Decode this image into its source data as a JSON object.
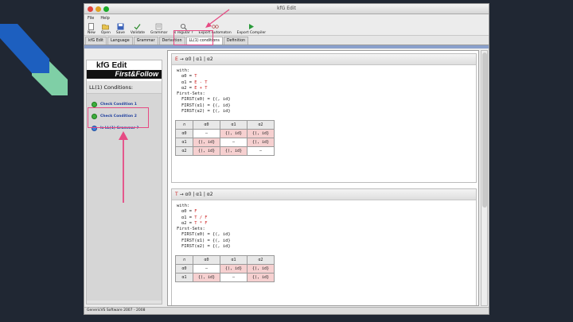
{
  "colors": {
    "background": "#202733",
    "deco_blue": "#1d5fbf",
    "deco_green": "#7fcfa6",
    "highlight": "#e64a83"
  },
  "window": {
    "title": "kfG Edit"
  },
  "menu": [
    "File",
    "Help"
  ],
  "toolbar": [
    {
      "label": "New",
      "icon": "new-file-icon"
    },
    {
      "label": "Open",
      "icon": "open-folder-icon"
    },
    {
      "label": "Save",
      "icon": "save-icon"
    },
    {
      "label": "Validate",
      "icon": "validate-icon"
    },
    {
      "label": "Grammar",
      "icon": "grammar-icon"
    },
    {
      "label": "Is regular ?",
      "icon": "regular-check-icon"
    },
    {
      "label": "Export Automaton",
      "icon": "export-automaton-icon"
    },
    {
      "label": "Export Compiler",
      "icon": "export-compiler-icon"
    }
  ],
  "tabs": [
    "kfG Edit",
    "Language",
    "Grammar",
    "Derivation",
    "LL(1) conditions",
    "Definition"
  ],
  "active_tab": "LL(1) conditions",
  "sidebar": {
    "logo_top": "kfG Edit",
    "logo_bottom": "First&Follow",
    "heading": "LL(1) Conditions:",
    "items": [
      {
        "label": "Check Condition 1"
      },
      {
        "label": "Check Condition 2"
      },
      {
        "label": "Is LL(1) Grammar ?"
      }
    ]
  },
  "block1": {
    "lhs": "E",
    "arrow": "→",
    "rhs": "α0 | α1 | α2",
    "with_label": "with:",
    "defs": [
      {
        "name": "α0",
        "eq": "=",
        "val": "T"
      },
      {
        "name": "α1",
        "eq": "=",
        "val": "E - T"
      },
      {
        "name": "α2",
        "eq": "=",
        "val": "E + T"
      }
    ],
    "first_label": "First-Sets:",
    "firsts": [
      "FIRST(α0) = {(, id}",
      "FIRST(α1) = {(, id}",
      "FIRST(α2) = {(, id}"
    ],
    "table": {
      "corner": "∩",
      "headers": [
        "α0",
        "α1",
        "α2"
      ],
      "rows": [
        {
          "label": "α0",
          "cells": [
            "–",
            "{(, id}",
            "{(, id}"
          ]
        },
        {
          "label": "α1",
          "cells": [
            "{(, id}",
            "–",
            "{(, id}"
          ]
        },
        {
          "label": "α2",
          "cells": [
            "{(, id}",
            "{(, id}",
            "–"
          ]
        }
      ]
    }
  },
  "block2": {
    "lhs": "T",
    "arrow": "→",
    "rhs": "α0 | α1 | α2",
    "with_label": "with:",
    "defs": [
      {
        "name": "α0",
        "eq": "=",
        "val": "F"
      },
      {
        "name": "α1",
        "eq": "=",
        "val": "T / F"
      },
      {
        "name": "α2",
        "eq": "=",
        "val": "T * F"
      }
    ],
    "first_label": "First-Sets:",
    "firsts": [
      "FIRST(α0) = {(, id}",
      "FIRST(α1) = {(, id}",
      "FIRST(α2) = {(, id}"
    ],
    "table": {
      "corner": "∩",
      "headers": [
        "α0",
        "α1",
        "α2"
      ],
      "rows": [
        {
          "label": "α0",
          "cells": [
            "–",
            "{(, id}",
            "{(, id}"
          ]
        },
        {
          "label": "α1",
          "cells": [
            "{(, id}",
            "–",
            "{(, id}"
          ]
        }
      ]
    }
  },
  "status": "GenericVS Software 2007 - 2008"
}
